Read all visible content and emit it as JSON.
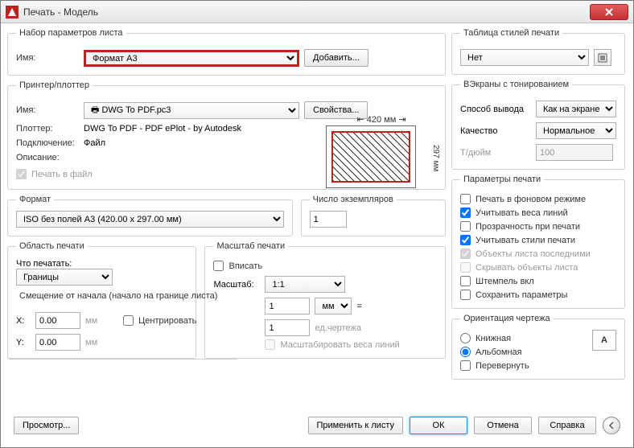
{
  "window": {
    "title": "Печать - Модель"
  },
  "pageSetup": {
    "legend": "Набор параметров листа",
    "nameLabel": "Имя:",
    "name": "Формат А3",
    "addBtn": "Добавить..."
  },
  "printer": {
    "legend": "Принтер/плоттер",
    "nameLabel": "Имя:",
    "name": "DWG To PDF.pc3",
    "propsBtn": "Свойства...",
    "plotterLabel": "Плоттер:",
    "plotter": "DWG To PDF - PDF ePlot - by Autodesk",
    "connLabel": "Подключение:",
    "conn": "Файл",
    "descLabel": "Описание:",
    "toFile": "Печать в файл",
    "dimTop": "420 мм",
    "dimRight": "297 мм"
  },
  "format": {
    "legend": "Формат",
    "value": "ISO без полей A3 (420.00 x 297.00 мм)"
  },
  "copies": {
    "legend": "Число экземпляров",
    "value": "1"
  },
  "area": {
    "legend": "Область печати",
    "whatLabel": "Что печатать:",
    "what": "Границы"
  },
  "scale": {
    "legend": "Масштаб печати",
    "fit": "Вписать",
    "scaleLabel": "Масштаб:",
    "scale": "1:1",
    "val1": "1",
    "unit": "мм",
    "eq": "=",
    "val2": "1",
    "unit2": "ед.чертежа",
    "lw": "Масштабировать веса линий"
  },
  "offset": {
    "legend": "Смещение от начала (начало на границе листа)",
    "x": "X:",
    "xv": "0.00",
    "y": "Y:",
    "yv": "0.00",
    "mm": "мм",
    "center": "Центрировать"
  },
  "styles": {
    "legend": "Таблица стилей печати",
    "value": "Нет"
  },
  "viewports": {
    "legend": "ВЭкраны с тонированием",
    "outLabel": "Способ вывода",
    "out": "Как на экране",
    "qLabel": "Качество",
    "q": "Нормальное",
    "dpiLabel": "Т/дюйм",
    "dpi": "100"
  },
  "options": {
    "legend": "Параметры печати",
    "bg": "Печать в фоновом режиме",
    "lw": "Учитывать веса линий",
    "tr": "Прозрачность при печати",
    "st": "Учитывать стили печати",
    "pl": "Объекты листа последними",
    "hide": "Скрывать объекты листа",
    "stamp": "Штемпель вкл",
    "save": "Сохранить параметры"
  },
  "orient": {
    "legend": "Ориентация чертежа",
    "port": "Книжная",
    "land": "Альбомная",
    "rev": "Перевернуть",
    "letter": "A"
  },
  "buttons": {
    "preview": "Просмотр...",
    "apply": "Применить к листу",
    "ok": "ОК",
    "cancel": "Отмена",
    "help": "Справка"
  }
}
